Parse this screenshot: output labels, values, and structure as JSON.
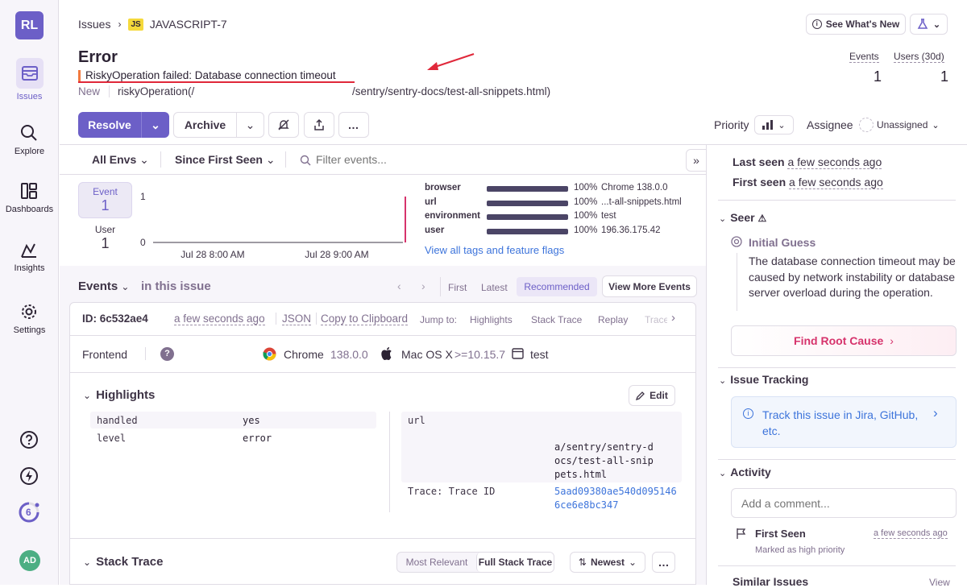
{
  "sidebar": {
    "org_initials": "RL",
    "items": [
      {
        "label": "Issues",
        "icon": "issues-icon"
      },
      {
        "label": "Explore",
        "icon": "search-icon"
      },
      {
        "label": "Dashboards",
        "icon": "dashboard-icon"
      },
      {
        "label": "Insights",
        "icon": "chart-icon"
      },
      {
        "label": "Settings",
        "icon": "gear-icon"
      }
    ],
    "onboarding_count": "6",
    "user_initials": "AD"
  },
  "breadcrumb": {
    "root": "Issues",
    "project_badge": "JS",
    "issue_id": "JAVASCRIPT-7"
  },
  "header_buttons": {
    "whats_new": "See What's New"
  },
  "issue": {
    "title": "Error",
    "message": "RiskyOperation failed: Database connection timeout",
    "status": "New",
    "location_prefix": "riskyOperation(/",
    "location_suffix": "/sentry/sentry-docs/test-all-snippets.html)"
  },
  "stats": {
    "events_label": "Events",
    "events_value": "1",
    "users_label": "Users (30d)",
    "users_value": "1"
  },
  "actions": {
    "resolve": "Resolve",
    "archive": "Archive",
    "priority_label": "Priority",
    "assignee_label": "Assignee",
    "assignee_value": "Unassigned"
  },
  "filters": {
    "envs": "All Envs",
    "since": "Since First Seen",
    "search_placeholder": "Filter events..."
  },
  "chart_data": {
    "type": "bar",
    "series": [
      {
        "name": "Event",
        "values": [
          0,
          1
        ]
      }
    ],
    "x": [
      "Jul 28 8:00 AM",
      "Jul 28 9:00 AM"
    ],
    "ylim": [
      0,
      1
    ],
    "yticks": [
      "1",
      "0"
    ],
    "legend": [
      {
        "label": "Event",
        "value": "1"
      },
      {
        "label": "User",
        "value": "1"
      }
    ]
  },
  "tags": [
    {
      "key": "browser",
      "pct": "100%",
      "value": "Chrome 138.0.0",
      "fill": 1
    },
    {
      "key": "url",
      "pct": "100%",
      "value": "...t-all-snippets.html",
      "fill": 1
    },
    {
      "key": "environment",
      "pct": "100%",
      "value": "test",
      "fill": 1
    },
    {
      "key": "user",
      "pct": "100%",
      "value": "196.36.175.42",
      "fill": 1
    }
  ],
  "tags_link": "View all tags and feature flags",
  "events_bar": {
    "title": "Events",
    "scope": "in this issue",
    "first": "First",
    "latest": "Latest",
    "recommended": "Recommended",
    "more": "View More Events"
  },
  "event": {
    "id": "ID: 6c532ae4",
    "time": "a few seconds ago",
    "json": "JSON",
    "copy": "Copy to Clipboard",
    "jump_to": "Jump to:",
    "jumps": [
      "Highlights",
      "Stack Trace",
      "Replay",
      "Trace"
    ],
    "context_name": "Frontend",
    "browser": "Chrome",
    "browser_version": "138.0.0",
    "os": "Mac OS X",
    "os_version": ">=10.15.7",
    "env": "test"
  },
  "highlights": {
    "title": "Highlights",
    "edit": "Edit",
    "left": [
      {
        "k": "handled",
        "v": "yes"
      },
      {
        "k": "level",
        "v": "error"
      }
    ],
    "url_key": "url",
    "url_value": "a/sentry/sentry-docs/test-all-snippets.html",
    "trace_key": "Trace: Trace ID",
    "trace_value": "5aad09380ae540d0951466ce6e8bc347"
  },
  "stack": {
    "title": "Stack Trace",
    "most_relevant": "Most Relevant",
    "full": "Full Stack Trace",
    "sort": "Newest"
  },
  "right": {
    "last_seen_label": "Last seen",
    "last_seen": "a few seconds ago",
    "first_seen_label": "First seen",
    "first_seen": "a few seconds ago",
    "seer": "Seer",
    "initial_guess": "Initial Guess",
    "guess_text": "The database connection timeout may be caused by network instability or database server overload during the operation.",
    "find_root": "Find Root Cause",
    "issue_tracking": "Issue Tracking",
    "track_link": "Track this issue in Jira, GitHub, etc.",
    "activity": "Activity",
    "comment_placeholder": "Add a comment...",
    "first_seen_item": "First Seen",
    "first_seen_item_time": "a few seconds ago",
    "first_seen_note": "Marked as high priority",
    "similar": "Similar Issues",
    "view": "View"
  },
  "colors": {
    "accent": "#6c5fc7",
    "link": "#3d74db",
    "annotation": "#e0283a"
  }
}
